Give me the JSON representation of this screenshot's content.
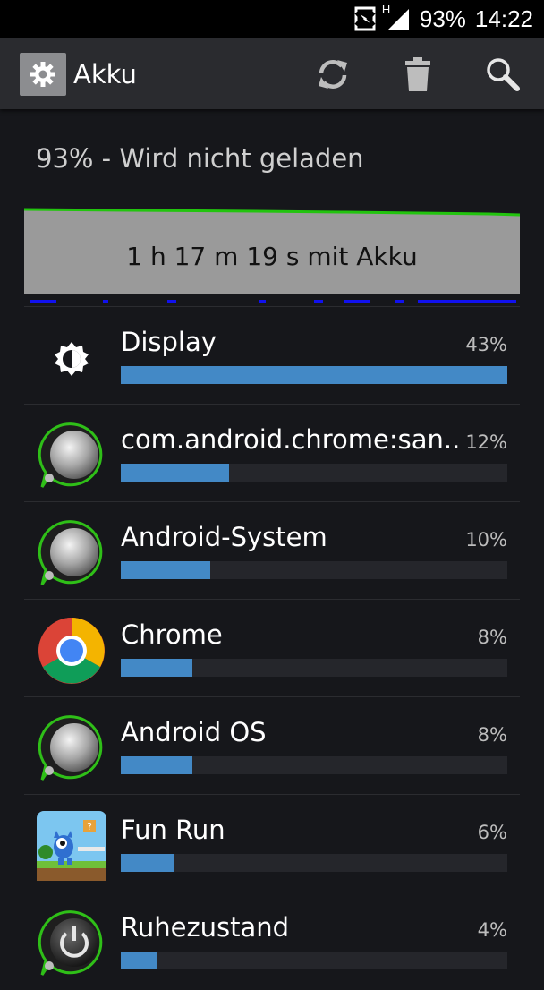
{
  "status_bar": {
    "battery": "93%",
    "time": "14:22",
    "network_type": "H",
    "icons": [
      "nfc-icon",
      "signal-icon"
    ]
  },
  "action_bar": {
    "title": "Akku",
    "app_icon": "gear-icon",
    "actions": [
      "refresh-icon",
      "trash-icon",
      "search-icon"
    ]
  },
  "battery_status": "93% - Wird nicht geladen",
  "graph": {
    "label": "1 h 17 m 19 s mit Akku",
    "line_color": "#22c40e",
    "fill_color": "#9a9a9a",
    "indicator_color": "#1111ee"
  },
  "colors": {
    "bar_fill": "#4389c6",
    "bar_track": "#25262b"
  },
  "usage": [
    {
      "name": "Display",
      "percent_label": "43%",
      "percent": 43,
      "icon": "display-brightness-icon"
    },
    {
      "name": "com.android.chrome:san..",
      "percent_label": "12%",
      "percent": 12,
      "icon": "android-system-icon"
    },
    {
      "name": "Android-System",
      "percent_label": "10%",
      "percent": 10,
      "icon": "android-system-icon"
    },
    {
      "name": "Chrome",
      "percent_label": "8%",
      "percent": 8,
      "icon": "chrome-icon"
    },
    {
      "name": "Android OS",
      "percent_label": "8%",
      "percent": 8,
      "icon": "android-system-icon"
    },
    {
      "name": "Fun Run",
      "percent_label": "6%",
      "percent": 6,
      "icon": "fun-run-icon"
    },
    {
      "name": "Ruhezustand",
      "percent_label": "4%",
      "percent": 4,
      "icon": "power-icon"
    }
  ]
}
